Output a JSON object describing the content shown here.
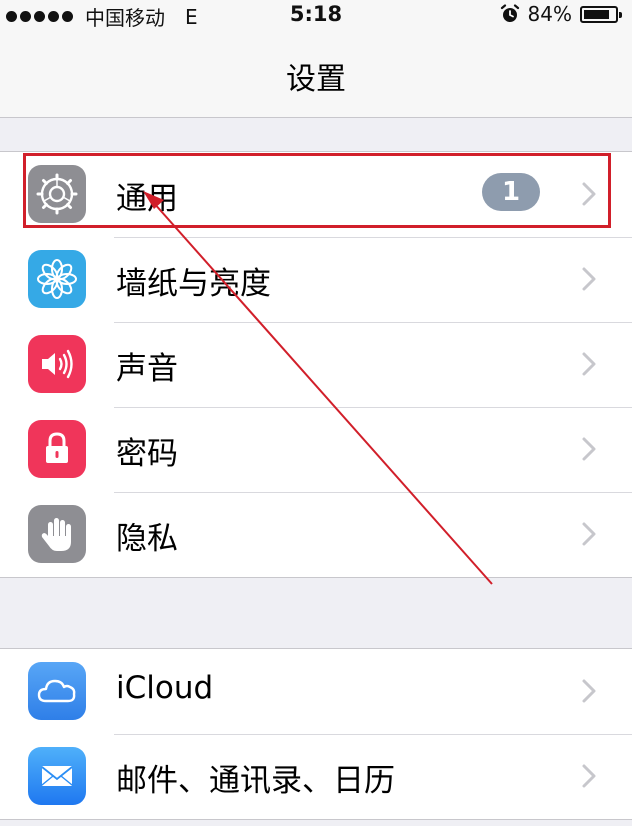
{
  "status_bar": {
    "carrier": "中国移动",
    "network": "E",
    "time": "5:18",
    "battery": "84%",
    "battery_level": 0.84,
    "icons": [
      "signal-dots-icon",
      "alarm-icon",
      "battery-icon"
    ]
  },
  "nav": {
    "title": "设置"
  },
  "group1": [
    {
      "label": "通用",
      "icon": "gear-icon",
      "color": "#8e8e93",
      "badge": "1"
    },
    {
      "label": "墙纸与亮度",
      "icon": "flower-icon",
      "color": "#35a9e6"
    },
    {
      "label": "声音",
      "icon": "speaker-icon",
      "color": "#f0355a"
    },
    {
      "label": "密码",
      "icon": "lock-icon",
      "color": "#f0355a"
    },
    {
      "label": "隐私",
      "icon": "hand-icon",
      "color": "#8e8e93"
    }
  ],
  "group2": [
    {
      "label": "iCloud",
      "icon": "cloud-icon",
      "color": "#3d8ff0"
    },
    {
      "label": "邮件、通讯录、日历",
      "icon": "envelope-icon",
      "color": "#2a8ef5"
    }
  ],
  "annotation": {
    "color": "#d11f2a"
  }
}
